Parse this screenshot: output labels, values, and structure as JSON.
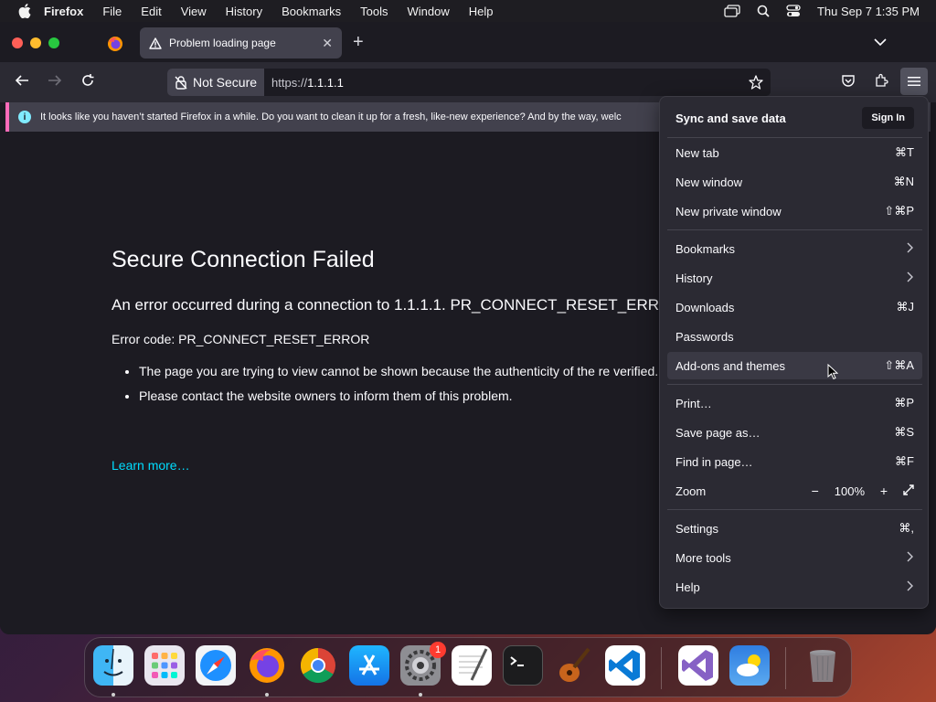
{
  "menubar": {
    "app_name": "Firefox",
    "items": [
      "File",
      "Edit",
      "View",
      "History",
      "Bookmarks",
      "Tools",
      "Window",
      "Help"
    ],
    "clock": "Thu Sep 7  1:35 PM"
  },
  "tab": {
    "title": "Problem loading page"
  },
  "urlbar": {
    "security_label": "Not Secure",
    "url_scheme": "https://",
    "url_host": "1.1.1.1"
  },
  "notice": {
    "text": "It looks like you haven’t started Firefox in a while. Do you want to clean it up for a fresh, like-new experience? And by the way, welc"
  },
  "error": {
    "title": "Secure Connection Failed",
    "description": "An error occurred during a connection to 1.1.1.1. PR_CONNECT_RESET_ERROR",
    "code_line": "Error code: PR_CONNECT_RESET_ERROR",
    "bullets": [
      "The page you are trying to view cannot be shown because the authenticity of the re verified.",
      "Please contact the website owners to inform them of this problem."
    ],
    "learn_more": "Learn more…"
  },
  "appmenu": {
    "sync_title": "Sync and save data",
    "sign_in": "Sign In",
    "items": [
      {
        "label": "New tab",
        "shortcut": "⌘T"
      },
      {
        "label": "New window",
        "shortcut": "⌘N"
      },
      {
        "label": "New private window",
        "shortcut": "⇧⌘P"
      },
      {
        "label": "Bookmarks",
        "shortcut": ""
      },
      {
        "label": "History",
        "shortcut": ""
      },
      {
        "label": "Downloads",
        "shortcut": "⌘J"
      },
      {
        "label": "Passwords",
        "shortcut": ""
      },
      {
        "label": "Add-ons and themes",
        "shortcut": "⇧⌘A"
      },
      {
        "label": "Print…",
        "shortcut": "⌘P"
      },
      {
        "label": "Save page as…",
        "shortcut": "⌘S"
      },
      {
        "label": "Find in page…",
        "shortcut": "⌘F"
      },
      {
        "label": "Zoom",
        "shortcut": ""
      },
      {
        "label": "Settings",
        "shortcut": "⌘,"
      },
      {
        "label": "More tools",
        "shortcut": ""
      },
      {
        "label": "Help",
        "shortcut": ""
      }
    ],
    "zoom_value": "100%",
    "zoom_minus": "−",
    "zoom_plus": "+"
  },
  "dock": {
    "settings_badge": "1",
    "icons": [
      "finder-icon",
      "launchpad-icon",
      "safari-icon",
      "firefox-icon",
      "chrome-icon",
      "app-store-icon",
      "system-settings-icon",
      "textedit-icon",
      "terminal-icon",
      "garageband-icon",
      "vscode-icon",
      "visual-studio-icon",
      "weather-icon",
      "trash-icon"
    ]
  }
}
